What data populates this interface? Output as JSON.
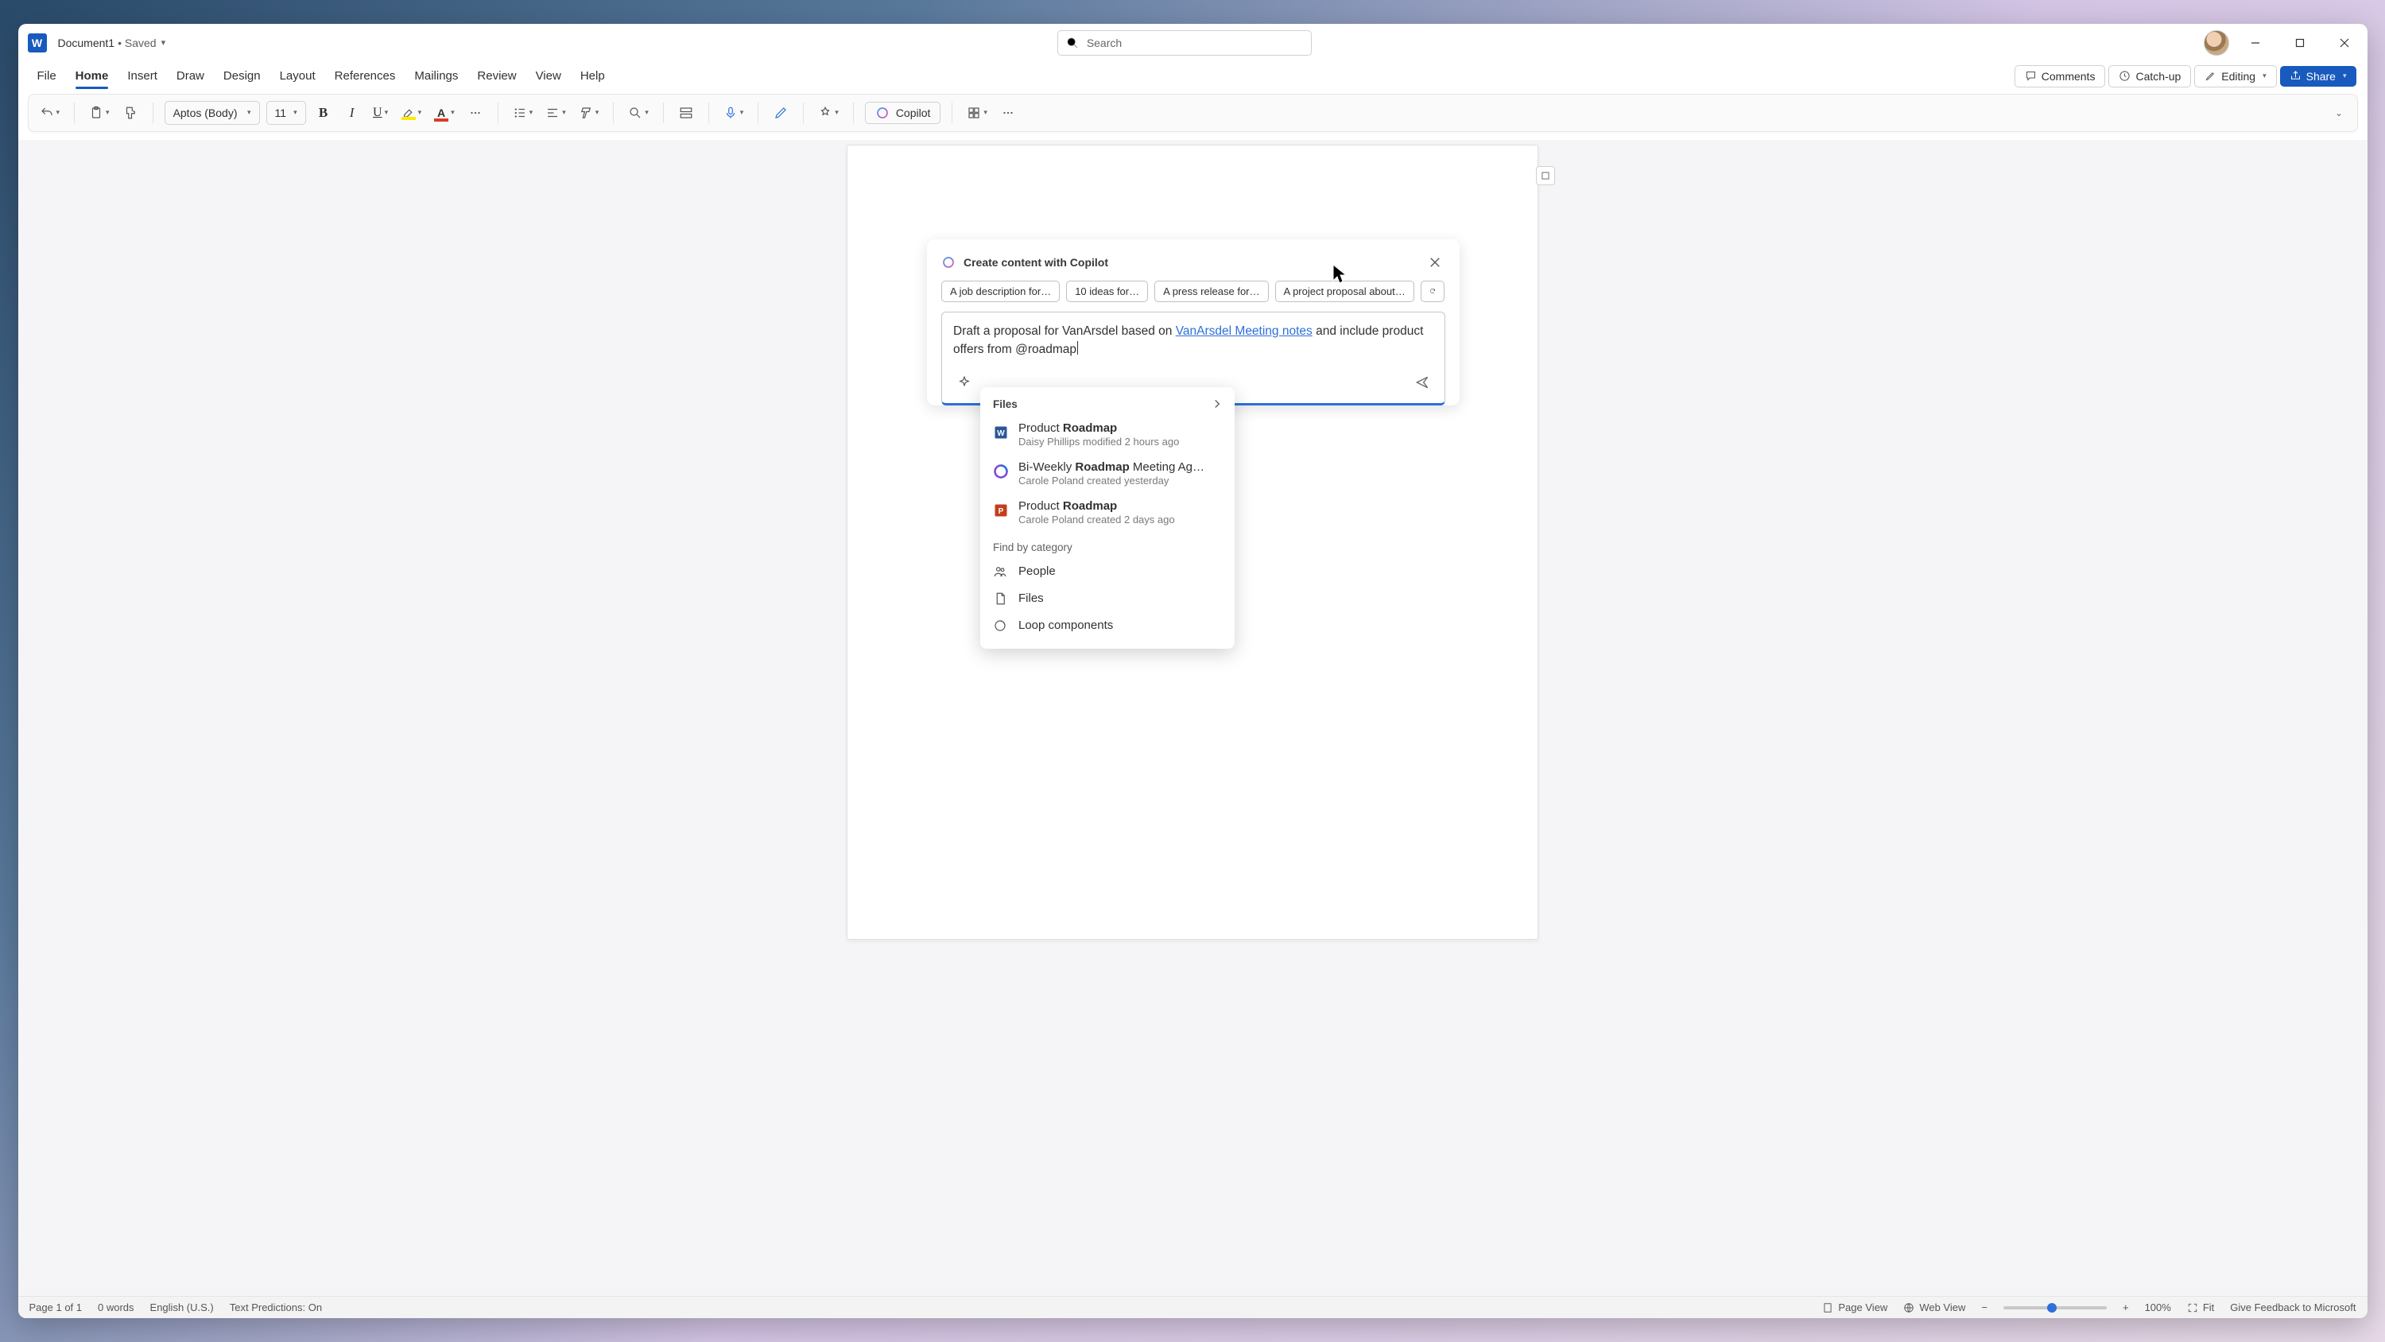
{
  "titlebar": {
    "doc_name": "Document1",
    "status": "Saved",
    "search_placeholder": "Search"
  },
  "tabs": {
    "items": [
      "File",
      "Home",
      "Insert",
      "Draw",
      "Design",
      "Layout",
      "References",
      "Mailings",
      "Review",
      "View",
      "Help"
    ],
    "active": "Home",
    "comments": "Comments",
    "catchup": "Catch-up",
    "editing": "Editing",
    "share": "Share"
  },
  "ribbon": {
    "font_name": "Aptos (Body)",
    "font_size": "11",
    "copilot_label": "Copilot"
  },
  "copilot": {
    "title": "Create content with Copilot",
    "chips": [
      "A job description for…",
      "10 ideas for…",
      "A press release for…",
      "A project proposal about…"
    ],
    "prompt_pre": "Draft a proposal for VanArsdel based on ",
    "prompt_link": "VanArsdel Meeting notes",
    "prompt_mid": " and include product offers from ",
    "prompt_tag": "@roadmap"
  },
  "file_pop": {
    "header": "Files",
    "items": [
      {
        "icon": "word",
        "name_pre": "Product ",
        "name_b": "Roadmap",
        "name_post": "",
        "meta": "Daisy Phillips modified 2 hours ago"
      },
      {
        "icon": "loop",
        "name_pre": "Bi-Weekly ",
        "name_b": "Roadmap",
        "name_post": " Meeting Ag…",
        "meta": "Carole Poland created yesterday"
      },
      {
        "icon": "ppt",
        "name_pre": "Product ",
        "name_b": "Roadmap",
        "name_post": "",
        "meta": "Carole Poland created 2 days ago"
      }
    ],
    "category_header": "Find by category",
    "categories": [
      "People",
      "Files",
      "Loop components"
    ]
  },
  "statusbar": {
    "page": "Page 1 of 1",
    "words": "0 words",
    "lang": "English (U.S.)",
    "pred": "Text Predictions: On",
    "page_view": "Page View",
    "web_view": "Web View",
    "zoom": "100%",
    "fit": "Fit",
    "feedback": "Give Feedback to Microsoft"
  }
}
